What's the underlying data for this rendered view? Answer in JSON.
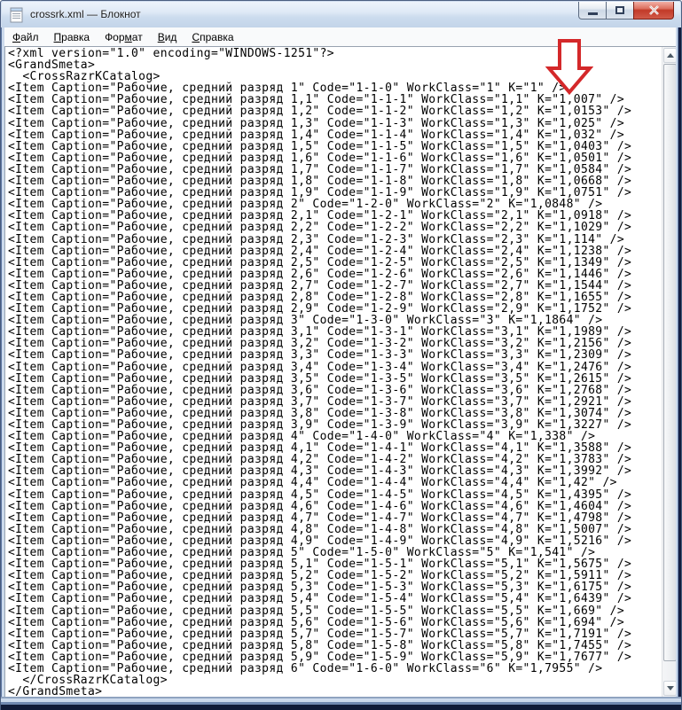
{
  "window": {
    "title": "crossrk.xml — Блокнот"
  },
  "icons": {
    "titlebar": "notepad-document-icon",
    "minimize": "minimize-icon",
    "maximize": "maximize-icon",
    "close": "close-icon",
    "scroll_up": "scroll-up-arrow-icon",
    "scroll_down": "scroll-down-arrow-icon",
    "annotation": "red-down-arrow-icon"
  },
  "menu": [
    {
      "name": "file",
      "pre": "",
      "key": "Ф",
      "post": "айл"
    },
    {
      "name": "edit",
      "pre": "",
      "key": "П",
      "post": "равка"
    },
    {
      "name": "format",
      "pre": "Фор",
      "key": "м",
      "post": "ат"
    },
    {
      "name": "view",
      "pre": "",
      "key": "В",
      "post": "ид"
    },
    {
      "name": "help",
      "pre": "",
      "key": "С",
      "post": "правка"
    }
  ],
  "document": {
    "prolog": [
      "<?xml version=\"1.0\" encoding=\"WINDOWS-1251\"?>",
      "<GrandSmeta>",
      "  <CrossRazrKCatalog>"
    ],
    "caption_prefix": "Рабочие, средний разряд ",
    "items": [
      {
        "r": "1",
        "c": "1-1-0",
        "k": "1"
      },
      {
        "r": "1,1",
        "c": "1-1-1",
        "k": "1,007"
      },
      {
        "r": "1,2",
        "c": "1-1-2",
        "k": "1,0153"
      },
      {
        "r": "1,3",
        "c": "1-1-3",
        "k": "1,025"
      },
      {
        "r": "1,4",
        "c": "1-1-4",
        "k": "1,032"
      },
      {
        "r": "1,5",
        "c": "1-1-5",
        "k": "1,0403"
      },
      {
        "r": "1,6",
        "c": "1-1-6",
        "k": "1,0501"
      },
      {
        "r": "1,7",
        "c": "1-1-7",
        "k": "1,0584"
      },
      {
        "r": "1,8",
        "c": "1-1-8",
        "k": "1,0668"
      },
      {
        "r": "1,9",
        "c": "1-1-9",
        "k": "1,0751"
      },
      {
        "r": "2",
        "c": "1-2-0",
        "k": "1,0848"
      },
      {
        "r": "2,1",
        "c": "1-2-1",
        "k": "1,0918"
      },
      {
        "r": "2,2",
        "c": "1-2-2",
        "k": "1,1029"
      },
      {
        "r": "2,3",
        "c": "1-2-3",
        "k": "1,114"
      },
      {
        "r": "2,4",
        "c": "1-2-4",
        "k": "1,1238"
      },
      {
        "r": "2,5",
        "c": "1-2-5",
        "k": "1,1349"
      },
      {
        "r": "2,6",
        "c": "1-2-6",
        "k": "1,1446"
      },
      {
        "r": "2,7",
        "c": "1-2-7",
        "k": "1,1544"
      },
      {
        "r": "2,8",
        "c": "1-2-8",
        "k": "1,1655"
      },
      {
        "r": "2,9",
        "c": "1-2-9",
        "k": "1,1752"
      },
      {
        "r": "3",
        "c": "1-3-0",
        "k": "1,1864"
      },
      {
        "r": "3,1",
        "c": "1-3-1",
        "k": "1,1989"
      },
      {
        "r": "3,2",
        "c": "1-3-2",
        "k": "1,2156"
      },
      {
        "r": "3,3",
        "c": "1-3-3",
        "k": "1,2309"
      },
      {
        "r": "3,4",
        "c": "1-3-4",
        "k": "1,2476"
      },
      {
        "r": "3,5",
        "c": "1-3-5",
        "k": "1,2615"
      },
      {
        "r": "3,6",
        "c": "1-3-6",
        "k": "1,2768"
      },
      {
        "r": "3,7",
        "c": "1-3-7",
        "k": "1,2921"
      },
      {
        "r": "3,8",
        "c": "1-3-8",
        "k": "1,3074"
      },
      {
        "r": "3,9",
        "c": "1-3-9",
        "k": "1,3227"
      },
      {
        "r": "4",
        "c": "1-4-0",
        "k": "1,338"
      },
      {
        "r": "4,1",
        "c": "1-4-1",
        "k": "1,3588"
      },
      {
        "r": "4,2",
        "c": "1-4-2",
        "k": "1,3783"
      },
      {
        "r": "4,3",
        "c": "1-4-3",
        "k": "1,3992"
      },
      {
        "r": "4,4",
        "c": "1-4-4",
        "k": "1,42"
      },
      {
        "r": "4,5",
        "c": "1-4-5",
        "k": "1,4395"
      },
      {
        "r": "4,6",
        "c": "1-4-6",
        "k": "1,4604"
      },
      {
        "r": "4,7",
        "c": "1-4-7",
        "k": "1,4798"
      },
      {
        "r": "4,8",
        "c": "1-4-8",
        "k": "1,5007"
      },
      {
        "r": "4,9",
        "c": "1-4-9",
        "k": "1,5216"
      },
      {
        "r": "5",
        "c": "1-5-0",
        "k": "1,541"
      },
      {
        "r": "5,1",
        "c": "1-5-1",
        "k": "1,5675"
      },
      {
        "r": "5,2",
        "c": "1-5-2",
        "k": "1,5911"
      },
      {
        "r": "5,3",
        "c": "1-5-3",
        "k": "1,6175"
      },
      {
        "r": "5,4",
        "c": "1-5-4",
        "k": "1,6439"
      },
      {
        "r": "5,5",
        "c": "1-5-5",
        "k": "1,669"
      },
      {
        "r": "5,6",
        "c": "1-5-6",
        "k": "1,694"
      },
      {
        "r": "5,7",
        "c": "1-5-7",
        "k": "1,7191"
      },
      {
        "r": "5,8",
        "c": "1-5-8",
        "k": "1,7455"
      },
      {
        "r": "5,9",
        "c": "1-5-9",
        "k": "1,7677"
      },
      {
        "r": "6",
        "c": "1-6-0",
        "k": "1,7955"
      }
    ],
    "epilog": [
      "  </CrossRazrKCatalog>",
      "</GrandSmeta>"
    ]
  },
  "annotation": {
    "type": "red-down-arrow",
    "points_at": "K=\"1,007\"",
    "color": "#d4282a"
  },
  "colors": {
    "titlebar_top": "#eef4fb",
    "titlebar_bottom": "#c3d4e9",
    "frame_light": "#ccdaec",
    "frame_dark": "#101b38",
    "close_button": "#c23a28",
    "text": "#000000",
    "editor_bg": "#ffffff"
  }
}
